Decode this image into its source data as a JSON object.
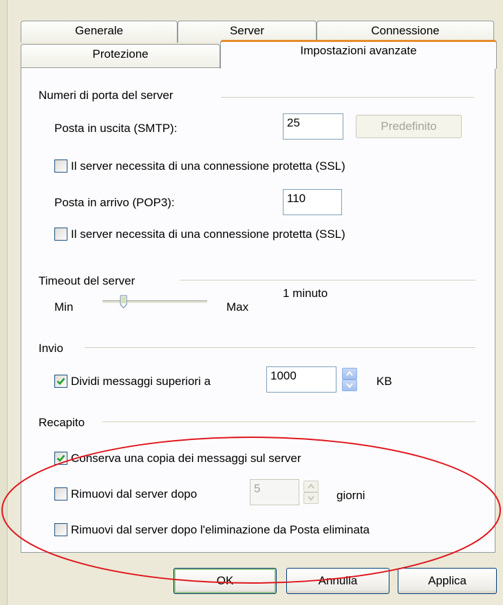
{
  "tabs": {
    "row1": [
      "Generale",
      "Server",
      "Connessione"
    ],
    "row2": [
      "Protezione",
      "Impostazioni avanzate"
    ],
    "active": "Impostazioni avanzate"
  },
  "ports": {
    "group_label": "Numeri di porta del server",
    "smtp_label": "Posta in uscita (SMTP):",
    "smtp_value": "25",
    "default_button": "Predefinito",
    "ssl_label": "Il server necessita di una connessione protetta (SSL)",
    "smtp_ssl_checked": false,
    "pop3_label": "Posta in arrivo (POP3):",
    "pop3_value": "110",
    "pop3_ssl_checked": false
  },
  "timeout": {
    "group_label": "Timeout del server",
    "min_label": "Min",
    "max_label": "Max",
    "value_label": "1 minuto",
    "level": 0.2
  },
  "sending": {
    "group_label": "Invio",
    "split_label": "Dividi messaggi superiori a",
    "split_checked": true,
    "split_value": "1000",
    "unit": "KB"
  },
  "delivery": {
    "group_label": "Recapito",
    "keep_copy_label": "Conserva una copia dei messaggi sul server",
    "keep_copy_checked": true,
    "remove_after_label": "Rimuovi dal server dopo",
    "remove_after_checked": false,
    "days_value": "5",
    "days_unit": "giorni",
    "remove_deleted_label": "Rimuovi dal server dopo l'eliminazione da Posta eliminata",
    "remove_deleted_checked": false
  },
  "buttons": {
    "ok": "OK",
    "cancel": "Annulla",
    "apply": "Applica"
  },
  "colors": {
    "annotation": "#e0151b",
    "check": "#21a121",
    "active_tab_accent": "#e68b2c"
  }
}
